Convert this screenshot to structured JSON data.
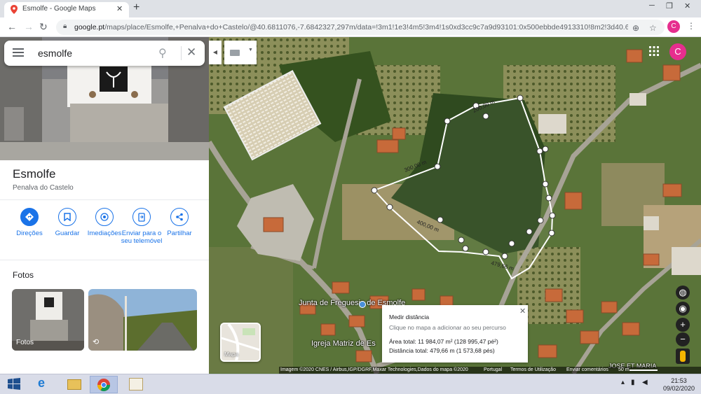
{
  "browser": {
    "tab_title": "Esmolfe - Google Maps",
    "tab_close": "✕",
    "new_tab": "+",
    "url_host": "google.pt",
    "url_path": "/maps/place/Esmolfe,+Penalva+do+Castelo/@40.6811076,-7.6842327,297m/data=!3m1!1e3!4m5!3m4!1s0xd3cc9c7a9d93101:0x500ebbde4913310!8m2!3d40.688...",
    "profile_letter": "C"
  },
  "search": {
    "query": "esmolfe"
  },
  "place": {
    "name": "Esmolfe",
    "region": "Penalva do Castelo",
    "actions": [
      {
        "label": "Direções"
      },
      {
        "label": "Guardar"
      },
      {
        "label": "Imediações"
      },
      {
        "label": "Enviar para o seu telemóvel"
      },
      {
        "label": "Partilhar"
      }
    ],
    "photos_heading": "Fotos",
    "photos_caption": "Fotos"
  },
  "map": {
    "labels": {
      "junta": "Junta de Freguesia de Esmolfe",
      "igreja": "Igreja Matriz de Es",
      "jose": "JOSE ET MARIA"
    },
    "segments": [
      "200,00 m",
      "300,00 m",
      "400,00 m",
      "479,66 m"
    ],
    "measure": {
      "title": "Medir distância",
      "hint": "Clique no mapa a adicionar ao seu percurso",
      "area": "Área total: 11 984,07 m² (128 995,47 pé²)",
      "distance": "Distância total: 479,66 m (1 573,68 pés)"
    },
    "minimap_label": "Mapa",
    "footer": {
      "imagery": "Imagem ©2020 CNES / Airbus,IGP/DGRF,Maxar Technologies,Dados do mapa ©2020",
      "country": "Portugal",
      "terms": "Termos de Utilização",
      "feedback": "Enviar comentários",
      "scale": "50 m"
    }
  },
  "taskbar": {
    "time": "21:53",
    "date": "09/02/2020"
  },
  "colors": {
    "accent": "#1a73e8",
    "avatar": "#e62e8e"
  }
}
